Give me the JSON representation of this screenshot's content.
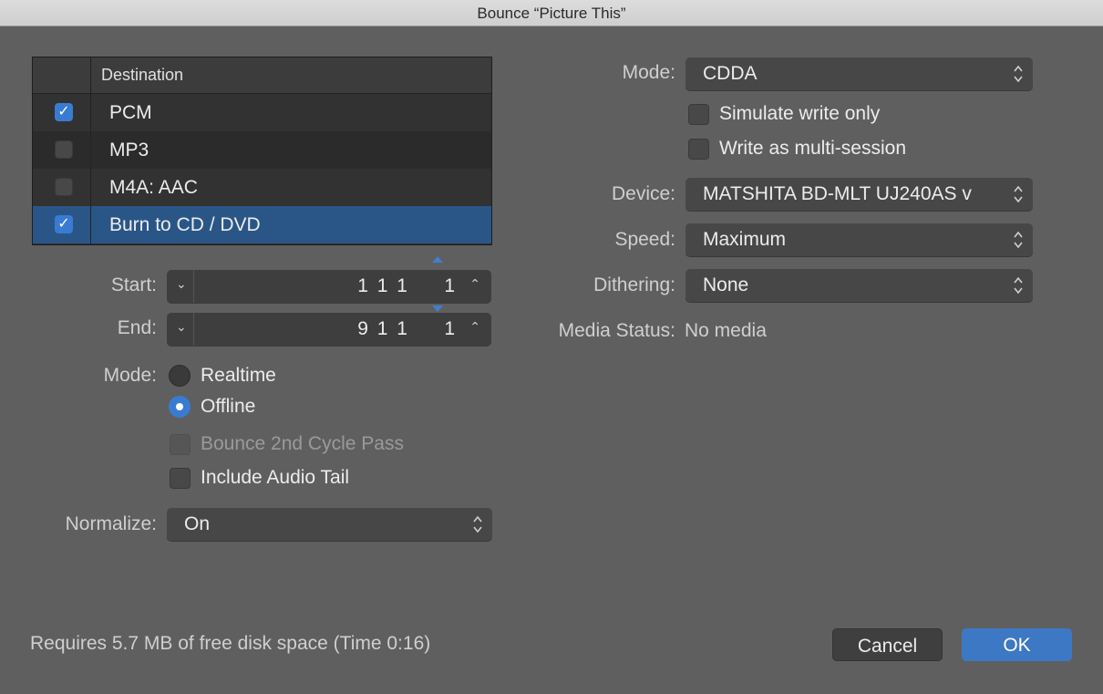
{
  "window": {
    "title": "Bounce “Picture This”"
  },
  "destination": {
    "header": "Destination",
    "rows": [
      {
        "label": "PCM",
        "checked": true
      },
      {
        "label": "MP3",
        "checked": false
      },
      {
        "label": "M4A: AAC",
        "checked": false
      },
      {
        "label": "Burn to CD / DVD",
        "checked": true
      }
    ]
  },
  "range": {
    "start_label": "Start:",
    "start_value": "1 1 1",
    "start_sub": "1",
    "end_label": "End:",
    "end_value": "9 1 1",
    "end_sub": "1"
  },
  "bounce_mode": {
    "label": "Mode:",
    "realtime": "Realtime",
    "offline": "Offline",
    "second_cycle": "Bounce 2nd Cycle Pass",
    "audio_tail": "Include Audio Tail"
  },
  "normalize": {
    "label": "Normalize:",
    "value": "On"
  },
  "burn": {
    "mode_label": "Mode:",
    "mode_value": "CDDA",
    "simulate": "Simulate write only",
    "multisession": "Write as multi-session",
    "device_label": "Device:",
    "device_value": "MATSHITA BD-MLT UJ240AS v",
    "speed_label": "Speed:",
    "speed_value": "Maximum",
    "dithering_label": "Dithering:",
    "dithering_value": "None",
    "media_status_label": "Media Status:",
    "media_status_value": "No media"
  },
  "footer": {
    "disk_info": "Requires 5.7 MB of free disk space  (Time 0:16)",
    "cancel": "Cancel",
    "ok": "OK"
  },
  "colors": {
    "accent": "#3a7bd2",
    "selected_row": "#2a5687",
    "background": "#5f5f5f"
  },
  "icons": {
    "checkmark": "checkmark-icon",
    "chevron_down": "chevron-down-icon",
    "chevron_up": "chevron-up-icon",
    "popup_arrows": "updown-arrows-icon"
  }
}
